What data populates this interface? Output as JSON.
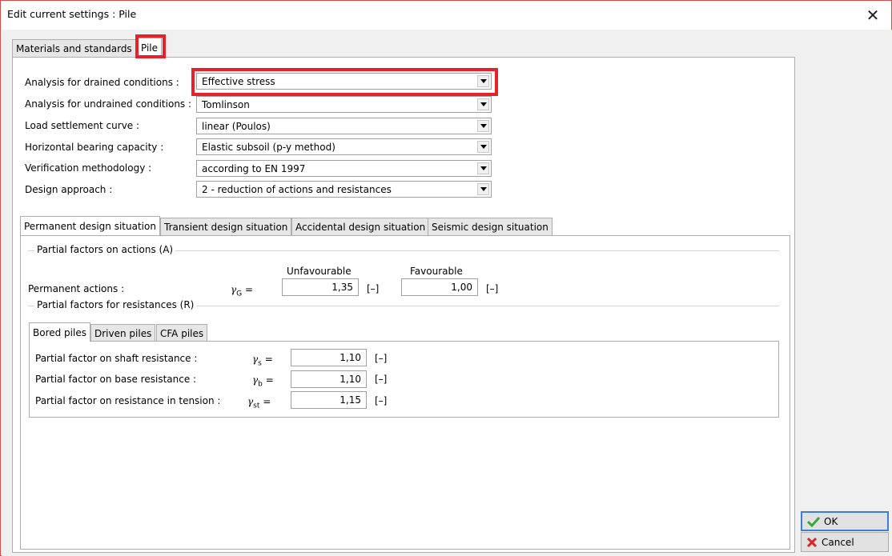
{
  "window": {
    "title": "Edit current settings : Pile",
    "close_glyph": "✕"
  },
  "top_tabs": [
    {
      "label": "Materials and standards"
    },
    {
      "label": "Pile"
    }
  ],
  "settings": [
    {
      "label": "Analysis for drained conditions :",
      "value": "Effective stress"
    },
    {
      "label": "Analysis for undrained conditions :",
      "value": "Tomlinson"
    },
    {
      "label": "Load settlement curve :",
      "value": "linear (Poulos)"
    },
    {
      "label": "Horizontal bearing capacity :",
      "value": "Elastic subsoil (p-y method)"
    },
    {
      "label": "Verification methodology :",
      "value": "according to EN 1997"
    },
    {
      "label": "Design approach :",
      "value": "2 - reduction of actions and resistances"
    }
  ],
  "situation_tabs": [
    {
      "label": "Permanent design situation"
    },
    {
      "label": "Transient design situation"
    },
    {
      "label": "Accidental design situation"
    },
    {
      "label": "Seismic design situation"
    }
  ],
  "actions_group": {
    "title": "Partial factors on actions (A)",
    "col_unfavourable": "Unfavourable",
    "col_favourable": "Favourable",
    "row_label": "Permanent actions :",
    "symbol": "γ",
    "symbol_sub": "G",
    "eq": " =",
    "unfavourable_value": "1,35",
    "favourable_value": "1,00",
    "unit": "[–]"
  },
  "resistances_group": {
    "title": "Partial factors for resistances (R)",
    "tabs": [
      {
        "label": "Bored piles"
      },
      {
        "label": "Driven piles"
      },
      {
        "label": "CFA piles"
      }
    ],
    "rows": [
      {
        "label": "Partial factor on shaft resistance :",
        "symbol": "γ",
        "sub": "s",
        "eq": " =",
        "value": "1,10",
        "unit": "[–]"
      },
      {
        "label": "Partial factor on base resistance :",
        "symbol": "γ",
        "sub": "b",
        "eq": " =",
        "value": "1,10",
        "unit": "[–]"
      },
      {
        "label": "Partial factor on resistance in tension :",
        "symbol": "γ",
        "sub": "st",
        "eq": " =",
        "value": "1,15",
        "unit": "[–]"
      }
    ]
  },
  "buttons": {
    "ok": "OK",
    "cancel": "Cancel"
  },
  "colors": {
    "highlight": "#e8202a",
    "ok_check": "#3aa63a",
    "cancel_x": "#d9262c"
  }
}
